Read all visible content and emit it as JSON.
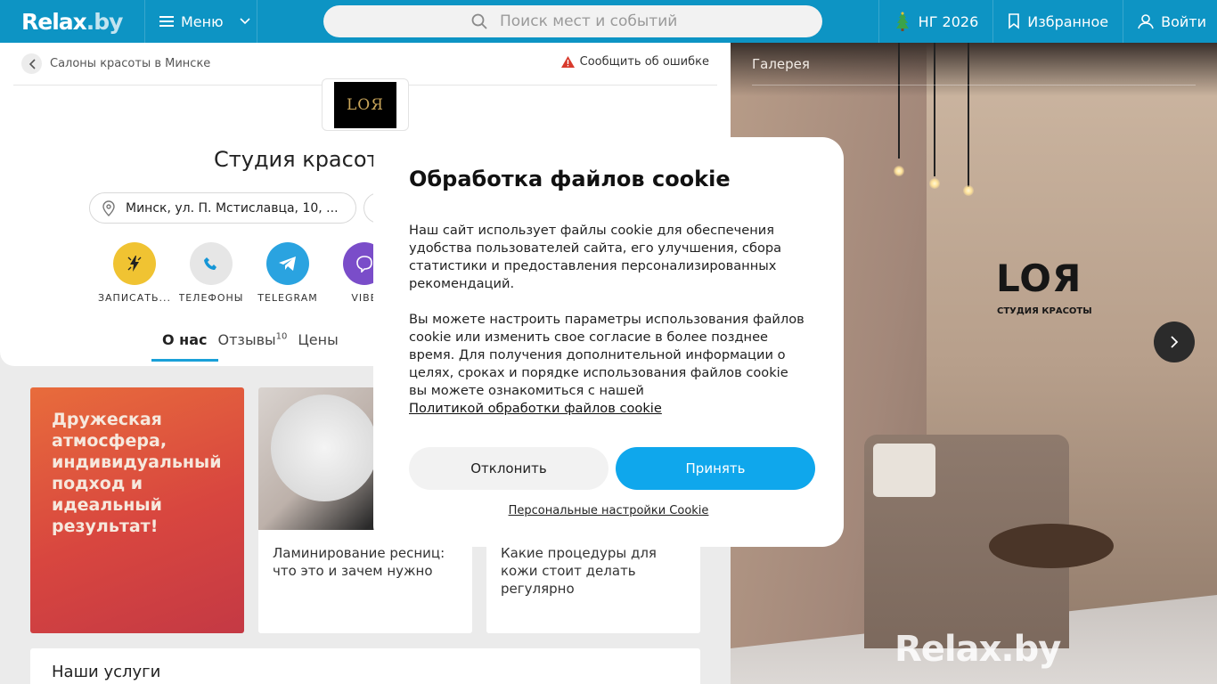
{
  "header": {
    "logo_text": "Relax",
    "logo_suffix": ".by",
    "menu_label": "Меню",
    "search_placeholder": "Поиск мест и событий",
    "ny_label": "НГ 2026",
    "favorites_label": "Избранное",
    "login_label": "Войти"
  },
  "place": {
    "breadcrumb": "Салоны красоты в Минске",
    "report_error": "Сообщить об ошибке",
    "brand_logo_text": "LOЯ",
    "title": "Студия красот",
    "address": "Минск, ул. П. Мстиславца, 10, ...",
    "actions": [
      {
        "label": "ЗАПИСАТЬ..."
      },
      {
        "label": "ТЕЛЕФОНЫ"
      },
      {
        "label": "TELEGRAM"
      },
      {
        "label": "VIBE"
      }
    ],
    "tabs": [
      {
        "label": "О нас",
        "count": ""
      },
      {
        "label": "Отзывы",
        "count": "10"
      },
      {
        "label": "Цены",
        "count": ""
      }
    ]
  },
  "cards": {
    "promo_text": "Дружеская атмосфера, индивидуальный подход и идеальный результат!",
    "article1": "Ламинирование ресниц: что это и зачем нужно",
    "article2": "Какие процедуры для кожи стоит делать регулярно",
    "services_title": "Наши услуги"
  },
  "gallery": {
    "title": "Галерея",
    "wall_logo": "LOЯ",
    "wall_sub": "СТУДИЯ КРАСОТЫ",
    "watermark": "Relax.by"
  },
  "cookie": {
    "title": "Обработка файлов cookie",
    "paragraph1": "Наш сайт использует файлы cookie для обеспечения удобства пользователей сайта, его улучшения, сбора статистики и предоставления персонализированных рекомендаций.",
    "paragraph2": "Вы можете настроить параметры использования файлов cookie или изменить свое согласие в более позднее время. Для получения дополнительной информации о целях, сроках и порядке использования файлов cookie вы можете ознакомиться с нашей",
    "policy_link": "Политикой обработки файлов cookie",
    "decline": "Отклонить",
    "accept": "Принять",
    "settings": "Персональные настройки Cookie"
  },
  "colors": {
    "header_bg": "#0d94c4",
    "accept_bg": "#0fa7ec",
    "tab_accent": "#1aa0d8",
    "booking_icon_bg": "#f0c332",
    "phone_icon_bg": "#e6e6e6",
    "telegram_bg": "#2aa3e0",
    "viber_bg": "#7a4dc9"
  },
  "icons": [
    "menu-icon",
    "chevron-down-icon",
    "search-icon",
    "tree-icon",
    "bookmark-icon",
    "user-icon",
    "back-arrow-icon",
    "warning-icon",
    "location-pin-icon",
    "lightning-icon",
    "phone-icon",
    "telegram-icon",
    "viber-icon",
    "chevron-right-icon"
  ]
}
